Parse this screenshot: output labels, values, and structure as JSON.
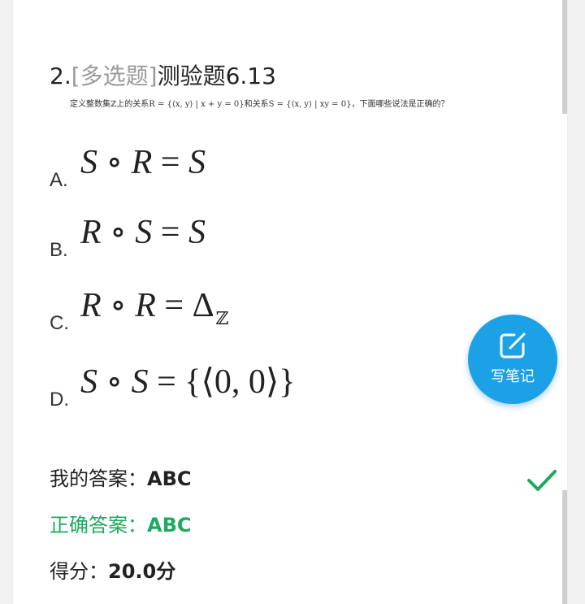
{
  "question": {
    "number": "2.",
    "type": "[多选题]",
    "title": "测验题6.13",
    "stem": "定义整数集ℤ上的关系R = {⟨x, y⟩ | x + y = 0}和关系S = {⟨x, y⟩ | xy = 0}，下面哪些说法是正确的？"
  },
  "options": [
    {
      "letter": "A.",
      "formula_left": "S",
      "formula_mid": "R",
      "formula_right": "S",
      "op": "∘",
      "eq": "="
    },
    {
      "letter": "B.",
      "formula_left": "R",
      "formula_mid": "S",
      "formula_right": "S",
      "op": "∘",
      "eq": "="
    },
    {
      "letter": "C.",
      "formula_left": "R",
      "formula_mid": "R",
      "formula_right": "Δ",
      "subscript": "ℤ",
      "op": "∘",
      "eq": "="
    },
    {
      "letter": "D.",
      "formula_left": "S",
      "formula_mid": "S",
      "formula_right": "{⟨0, 0⟩}",
      "op": "∘",
      "eq": "="
    }
  ],
  "note_button": {
    "label": "写笔记",
    "icon": "edit-note-icon"
  },
  "result": {
    "my_answer_label": "我的答案：",
    "my_answer_value": "ABC",
    "correct_answer_label": "正确答案：",
    "correct_answer_value": "ABC",
    "score_label": "得分：",
    "score_value": "20.0分",
    "status_icon": "check-icon"
  },
  "colors": {
    "accent_blue": "#1da1e6",
    "correct_green": "#1aab5e",
    "type_gray": "#9a9a9a"
  }
}
